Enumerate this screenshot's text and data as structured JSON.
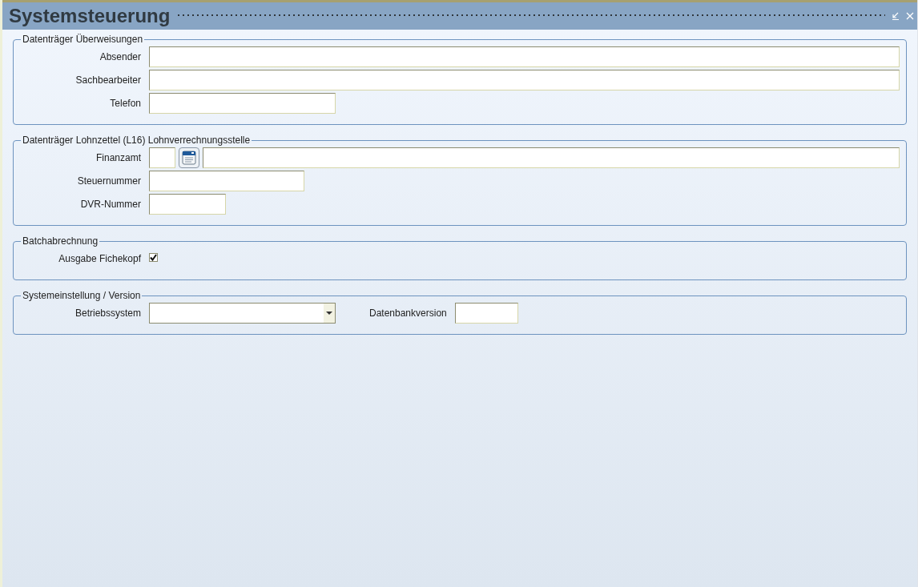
{
  "window": {
    "title": "Systemsteuerung"
  },
  "sections": [
    {
      "legend": "Datenträger Überweisungen",
      "rows": [
        {
          "fields": [
            {
              "kind": "text",
              "label": "Absender"
            }
          ]
        },
        {
          "fields": [
            {
              "kind": "text",
              "label": "Sachbearbeiter"
            }
          ]
        },
        {
          "fields": [
            {
              "kind": "text",
              "label": "Telefon"
            }
          ]
        }
      ]
    },
    {
      "legend": "Datenträger Lohnzettel (L16) Lohnverrechnungsstelle",
      "rows": [
        {
          "fields": [
            {
              "kind": "lookup",
              "label": "Finanzamt"
            }
          ]
        },
        {
          "fields": [
            {
              "kind": "text",
              "label": "Steuernummer"
            }
          ]
        },
        {
          "fields": [
            {
              "kind": "text",
              "label": "DVR-Nummer"
            }
          ]
        }
      ]
    },
    {
      "legend": "Batchabrechnung",
      "rows": [
        {
          "fields": [
            {
              "kind": "checkbox",
              "label": "Ausgabe Fichekopf",
              "checked": true
            }
          ]
        }
      ]
    },
    {
      "legend": "Systemeinstellung / Version",
      "rows": [
        {
          "fields": [
            {
              "kind": "select",
              "label": "Betriebssystem"
            },
            {
              "kind": "text",
              "label": "Datenbankversion"
            }
          ]
        }
      ]
    }
  ]
}
